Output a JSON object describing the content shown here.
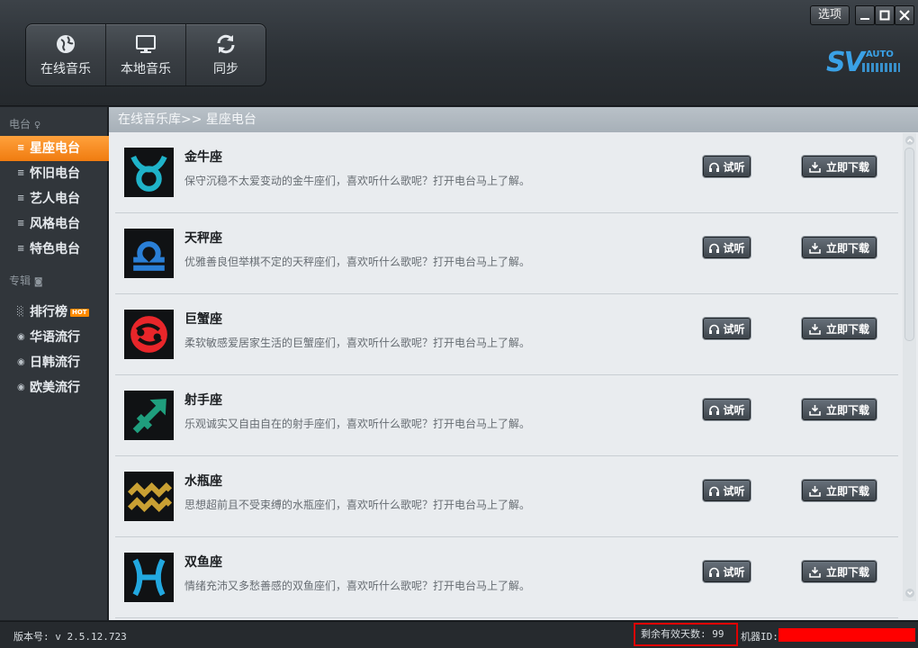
{
  "header": {
    "nav": [
      {
        "label": "在线音乐",
        "icon": "globe-icon"
      },
      {
        "label": "本地音乐",
        "icon": "monitor-icon"
      },
      {
        "label": "同步",
        "icon": "sync-icon"
      }
    ],
    "options_label": "选项",
    "logo_text": "SV",
    "logo_sub": "AUTO"
  },
  "sidebar": {
    "section_radio": "电台",
    "radio_items": [
      {
        "label": "星座电台",
        "active": true
      },
      {
        "label": "怀旧电台"
      },
      {
        "label": "艺人电台"
      },
      {
        "label": "风格电台"
      },
      {
        "label": "特色电台"
      }
    ],
    "section_album": "专辑",
    "album_items": [
      {
        "label": "排行榜",
        "badge": "HOT"
      },
      {
        "label": "华语流行"
      },
      {
        "label": "日韩流行"
      },
      {
        "label": "欧美流行"
      }
    ]
  },
  "breadcrumb": "在线音乐库>> 星座电台",
  "buttons": {
    "listen": "试听",
    "download": "立即下载"
  },
  "stations": [
    {
      "title": "金牛座",
      "desc": "保守沉稳不太爱变动的金牛座们，喜欢听什么歌呢？打开电台马上了解。",
      "icon": "taurus-icon",
      "color": "#1fb3c9"
    },
    {
      "title": "天秤座",
      "desc": "优雅善良但举棋不定的天秤座们，喜欢听什么歌呢？打开电台马上了解。",
      "icon": "libra-icon",
      "color": "#2a7fd6"
    },
    {
      "title": "巨蟹座",
      "desc": "柔软敏感爱居家生活的巨蟹座们，喜欢听什么歌呢？打开电台马上了解。",
      "icon": "cancer-icon",
      "color": "#e8262a"
    },
    {
      "title": "射手座",
      "desc": "乐观诚实又自由自在的射手座们，喜欢听什么歌呢？打开电台马上了解。",
      "icon": "sagittarius-icon",
      "color": "#1f9e7d"
    },
    {
      "title": "水瓶座",
      "desc": "思想超前且不受束缚的水瓶座们，喜欢听什么歌呢？打开电台马上了解。",
      "icon": "aquarius-icon",
      "color": "#c9a033"
    },
    {
      "title": "双鱼座",
      "desc": "情绪充沛又多愁善感的双鱼座们，喜欢听什么歌呢？打开电台马上了解。",
      "icon": "pisces-icon",
      "color": "#22a8e0"
    }
  ],
  "status": {
    "version": "版本号: v 2.5.12.723",
    "days_remaining": "剩余有效天数: 99",
    "machine_label": "机器ID:"
  }
}
